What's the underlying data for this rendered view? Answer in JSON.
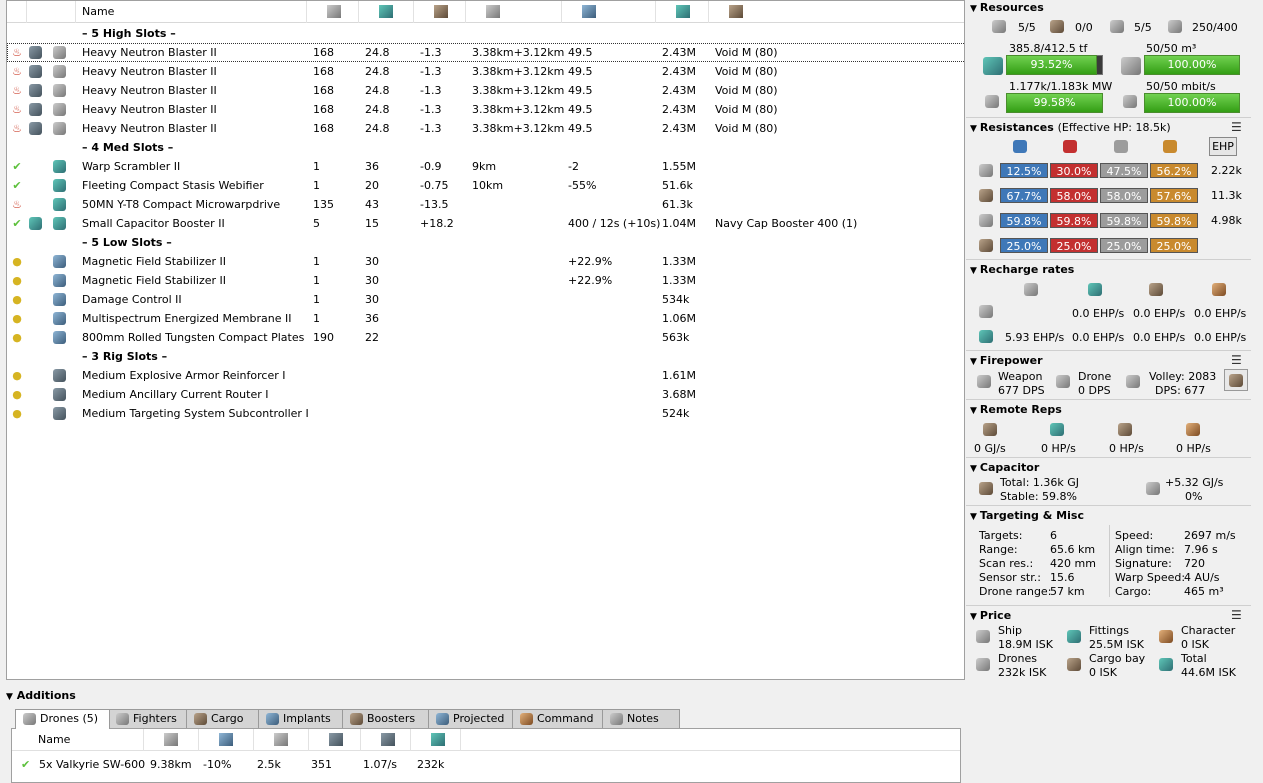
{
  "fitting": {
    "columns": {
      "name": "Name"
    },
    "slot_headers": {
      "high": "– 5 High Slots –",
      "med": "– 4 Med Slots –",
      "low": "– 5 Low Slots –",
      "rig": "– 3 Rig Slots –"
    },
    "high": [
      {
        "name": "Heavy Neutron Blaster II",
        "cpu": "168",
        "pg": "24.8",
        "cap": "-1.3",
        "range": "3.38km+3.12km",
        "c5": "49.5",
        "price": "2.43M",
        "charge": "Void M (80)"
      },
      {
        "name": "Heavy Neutron Blaster II",
        "cpu": "168",
        "pg": "24.8",
        "cap": "-1.3",
        "range": "3.38km+3.12km",
        "c5": "49.5",
        "price": "2.43M",
        "charge": "Void M (80)"
      },
      {
        "name": "Heavy Neutron Blaster II",
        "cpu": "168",
        "pg": "24.8",
        "cap": "-1.3",
        "range": "3.38km+3.12km",
        "c5": "49.5",
        "price": "2.43M",
        "charge": "Void M (80)"
      },
      {
        "name": "Heavy Neutron Blaster II",
        "cpu": "168",
        "pg": "24.8",
        "cap": "-1.3",
        "range": "3.38km+3.12km",
        "c5": "49.5",
        "price": "2.43M",
        "charge": "Void M (80)"
      },
      {
        "name": "Heavy Neutron Blaster II",
        "cpu": "168",
        "pg": "24.8",
        "cap": "-1.3",
        "range": "3.38km+3.12km",
        "c5": "49.5",
        "price": "2.43M",
        "charge": "Void M (80)"
      }
    ],
    "med": [
      {
        "name": "Warp Scrambler II",
        "cpu": "1",
        "pg": "36",
        "cap": "-0.9",
        "range": "9km",
        "c5": "-2",
        "price": "1.55M",
        "charge": ""
      },
      {
        "name": "Fleeting Compact Stasis Webifier",
        "cpu": "1",
        "pg": "20",
        "cap": "-0.75",
        "range": "10km",
        "c5": "-55%",
        "price": "51.6k",
        "charge": ""
      },
      {
        "name": "50MN Y-T8 Compact Microwarpdrive",
        "cpu": "135",
        "pg": "43",
        "cap": "-13.5",
        "range": "",
        "c5": "",
        "price": "61.3k",
        "charge": ""
      },
      {
        "name": "Small Capacitor Booster II",
        "cpu": "5",
        "pg": "15",
        "cap": "+18.2",
        "range": "",
        "c5": "400 / 12s (+10s)",
        "price": "1.04M",
        "charge": "Navy Cap Booster 400 (1)"
      }
    ],
    "low": [
      {
        "name": "Magnetic Field Stabilizer II",
        "cpu": "1",
        "pg": "30",
        "cap": "",
        "range": "",
        "c5": "+22.9%",
        "price": "1.33M",
        "charge": ""
      },
      {
        "name": "Magnetic Field Stabilizer II",
        "cpu": "1",
        "pg": "30",
        "cap": "",
        "range": "",
        "c5": "+22.9%",
        "price": "1.33M",
        "charge": ""
      },
      {
        "name": "Damage Control II",
        "cpu": "1",
        "pg": "30",
        "cap": "",
        "range": "",
        "c5": "",
        "price": "534k",
        "charge": ""
      },
      {
        "name": "Multispectrum Energized Membrane II",
        "cpu": "1",
        "pg": "36",
        "cap": "",
        "range": "",
        "c5": "",
        "price": "1.06M",
        "charge": ""
      },
      {
        "name": "800mm Rolled Tungsten Compact Plates",
        "cpu": "190",
        "pg": "22",
        "cap": "",
        "range": "",
        "c5": "",
        "price": "563k",
        "charge": ""
      }
    ],
    "rig": [
      {
        "name": "Medium Explosive Armor Reinforcer I",
        "price": "1.61M"
      },
      {
        "name": "Medium Ancillary Current Router I",
        "price": "3.68M"
      },
      {
        "name": "Medium Targeting System Subcontroller I",
        "price": "524k"
      }
    ]
  },
  "additions": {
    "title": "Additions",
    "tabs": [
      "Drones (5)",
      "Fighters",
      "Cargo",
      "Implants",
      "Boosters",
      "Projected",
      "Command",
      "Notes"
    ],
    "drone_columns": {
      "name": "Name"
    },
    "drones": [
      {
        "name": "5x Valkyrie SW-600",
        "range": "9.38km",
        "c2": "-10%",
        "c3": "2.5k",
        "c4": "351",
        "c5": "1.07/s",
        "price": "232k"
      }
    ]
  },
  "resources": {
    "title": "Resources",
    "counts": [
      "5/5",
      "0/0",
      "5/5",
      "250/400"
    ],
    "cpu_text": "385.8/412.5 tf",
    "cpu_pct": "93.52%",
    "cpu_fraction": 0.9352,
    "drone_bay_text": "50/50 m³",
    "drone_bay_pct": "100.00%",
    "pg_text": "1.177k/1.183k MW",
    "pg_pct": "99.58%",
    "bandwidth_text": "50/50 mbit/s",
    "bandwidth_pct": "100.00%"
  },
  "resistances": {
    "title": "Resistances",
    "ehp_label": "(Effective HP: 18.5k)",
    "ehp_button": "EHP",
    "rows": [
      {
        "values": [
          "12.5%",
          "30.0%",
          "47.5%",
          "56.2%"
        ],
        "hp": "2.22k"
      },
      {
        "values": [
          "67.7%",
          "58.0%",
          "58.0%",
          "57.6%"
        ],
        "hp": "11.3k"
      },
      {
        "values": [
          "59.8%",
          "59.8%",
          "59.8%",
          "59.8%"
        ],
        "hp": "4.98k"
      },
      {
        "values": [
          "25.0%",
          "25.0%",
          "25.0%",
          "25.0%"
        ],
        "hp": ""
      }
    ]
  },
  "recharge": {
    "title": "Recharge rates",
    "row1": [
      "0.0 EHP/s",
      "0.0 EHP/s",
      "0.0 EHP/s"
    ],
    "row2": [
      "5.93 EHP/s",
      "0.0 EHP/s",
      "0.0 EHP/s",
      "0.0 EHP/s"
    ]
  },
  "firepower": {
    "title": "Firepower",
    "weapon_label": "Weapon",
    "weapon_dps": "677 DPS",
    "drone_label": "Drone",
    "drone_dps": "0 DPS",
    "volley": "Volley: 2083",
    "dps": "DPS: 677"
  },
  "remote_reps": {
    "title": "Remote Reps",
    "values": [
      "0 GJ/s",
      "0 HP/s",
      "0 HP/s",
      "0 HP/s"
    ]
  },
  "capacitor": {
    "title": "Capacitor",
    "total": "Total: 1.36k GJ",
    "stable": "Stable: 59.8%",
    "delta": "+5.32 GJ/s",
    "delta_pct": "0%"
  },
  "targeting": {
    "title": "Targeting & Misc",
    "left": [
      {
        "label": "Targets:",
        "value": "6"
      },
      {
        "label": "Range:",
        "value": "65.6 km"
      },
      {
        "label": "Scan res.:",
        "value": "420 mm"
      },
      {
        "label": "Sensor str.:",
        "value": "15.6"
      },
      {
        "label": "Drone range:",
        "value": "57 km"
      }
    ],
    "right": [
      {
        "label": "Speed:",
        "value": "2697 m/s"
      },
      {
        "label": "Align time:",
        "value": "7.96 s"
      },
      {
        "label": "Signature:",
        "value": "720"
      },
      {
        "label": "Warp Speed:",
        "value": "4 AU/s"
      },
      {
        "label": "Cargo:",
        "value": "465 m³"
      }
    ]
  },
  "price": {
    "title": "Price",
    "items": [
      {
        "label": "Ship",
        "value": "18.9M ISK"
      },
      {
        "label": "Fittings",
        "value": "25.5M ISK"
      },
      {
        "label": "Character",
        "value": "0 ISK"
      },
      {
        "label": "Drones",
        "value": "232k ISK"
      },
      {
        "label": "Cargo bay",
        "value": "0 ISK"
      },
      {
        "label": "Total",
        "value": "44.6M ISK"
      }
    ]
  },
  "colors": {
    "active_green": "#5cc03b",
    "overheat_red": "#c8321e",
    "offline_yellow": "#d6b422",
    "em": "#3f78b8",
    "thermal": "#c33030",
    "kinetic": "#9c9c9c",
    "explosive": "#c98a2e"
  }
}
